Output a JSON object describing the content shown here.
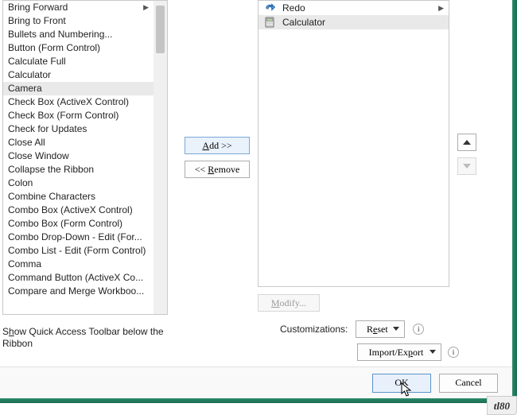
{
  "left_list": {
    "items": [
      {
        "label": "Bring Forward",
        "submenu": true
      },
      {
        "label": "Bring to Front"
      },
      {
        "label": "Bullets and Numbering..."
      },
      {
        "label": "Button (Form Control)"
      },
      {
        "label": "Calculate Full"
      },
      {
        "label": "Calculator"
      },
      {
        "label": "Camera",
        "selected": true
      },
      {
        "label": "Check Box (ActiveX Control)"
      },
      {
        "label": "Check Box (Form Control)"
      },
      {
        "label": "Check for Updates"
      },
      {
        "label": "Close All"
      },
      {
        "label": "Close Window"
      },
      {
        "label": "Collapse the Ribbon"
      },
      {
        "label": "Colon"
      },
      {
        "label": "Combine Characters"
      },
      {
        "label": "Combo Box (ActiveX Control)"
      },
      {
        "label": "Combo Box (Form Control)"
      },
      {
        "label": "Combo Drop-Down - Edit (For..."
      },
      {
        "label": "Combo List - Edit (Form Control)"
      },
      {
        "label": "Comma"
      },
      {
        "label": "Command Button (ActiveX Co..."
      },
      {
        "label": "Compare and Merge Workboo..."
      }
    ]
  },
  "right_list": {
    "items": [
      {
        "icon": "redo",
        "label": "Redo",
        "submenu": true
      },
      {
        "icon": "calculator",
        "label": "Calculator",
        "selected": true
      }
    ]
  },
  "buttons": {
    "add": "Add >>",
    "remove": "<< Remove",
    "move_up_title": "Move Up",
    "move_down_title": "Move Down",
    "modify": "Modify...",
    "reset": "Reset",
    "import_export": "Import/Export",
    "ok": "OK",
    "cancel": "Cancel"
  },
  "labels": {
    "customizations": "Customizations:",
    "show_below_pre": "S",
    "show_below_mid": "h",
    "show_below_rest": "ow Quick Access Toolbar below the Ribbon"
  },
  "watermark": "tl80"
}
